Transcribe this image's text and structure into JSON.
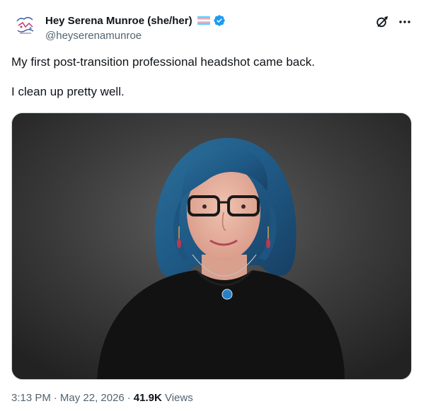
{
  "author": {
    "display_name": "Hey Serena Munroe (she/her)",
    "handle": "@heyserenamunroe",
    "flag_icon": "transgender-flag-icon",
    "verified_icon": "verified-badge-icon"
  },
  "actions": {
    "grok_icon": "grok-icon",
    "more_icon": "more-options-icon"
  },
  "tweet": {
    "line1": "My first post-transition professional headshot came back.",
    "line2": "I clean up pretty well."
  },
  "meta": {
    "time": "3:13 PM",
    "separator": "·",
    "date": "May 22, 2026",
    "views_count": "41.9K",
    "views_label": "Views"
  },
  "colors": {
    "text_primary": "#0f1419",
    "text_secondary": "#536471",
    "verified_blue": "#1d9bf0",
    "flag_blue": "#5bcefa",
    "flag_pink": "#f5a9b8"
  }
}
